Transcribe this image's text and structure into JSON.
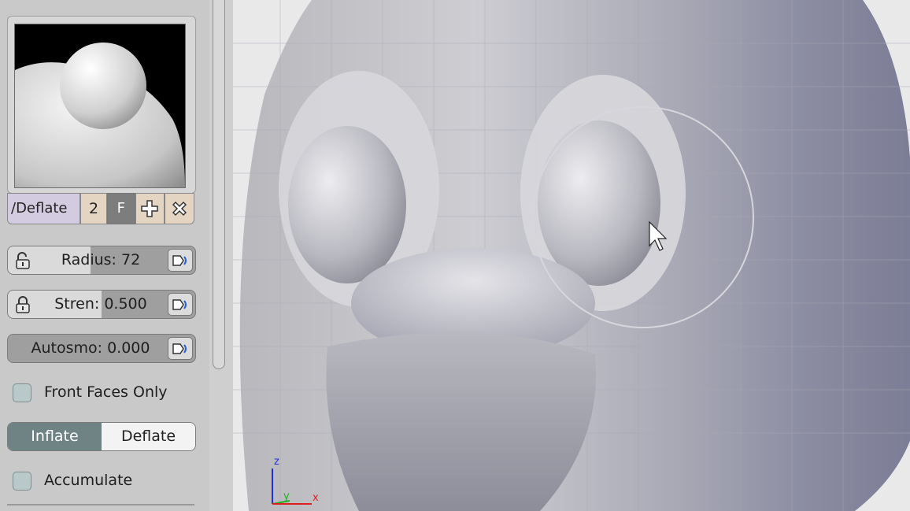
{
  "brush": {
    "name": "/Deflate",
    "users": "2",
    "fake_user": "F",
    "add_icon": "plus-icon",
    "remove_icon": "x-icon"
  },
  "sliders": {
    "radius": {
      "label": "Radius: 72",
      "fill": 0.44,
      "lock_icon": "unlock-icon",
      "pen_icon": "pen-pressure-icon"
    },
    "strength": {
      "label": "Stren: 0.500",
      "fill": 0.5,
      "lock_icon": "lock-icon",
      "pen_icon": "pen-pressure-icon"
    },
    "autosmooth": {
      "label": "Autosmo: 0.000",
      "fill": 0.0,
      "pen_icon": "pen-pressure-icon"
    }
  },
  "options": {
    "front_faces_only": {
      "label": "Front Faces Only",
      "checked": false
    },
    "accumulate": {
      "label": "Accumulate",
      "checked": false
    }
  },
  "direction": {
    "inflate": "Inflate",
    "deflate": "Deflate",
    "active": "inflate"
  },
  "axes": {
    "z": "z",
    "y": "y",
    "x": "x"
  },
  "colors": {
    "accent": "#6f8385",
    "axis_x": "#e02020",
    "axis_y": "#20b020",
    "axis_z": "#2030e0"
  }
}
